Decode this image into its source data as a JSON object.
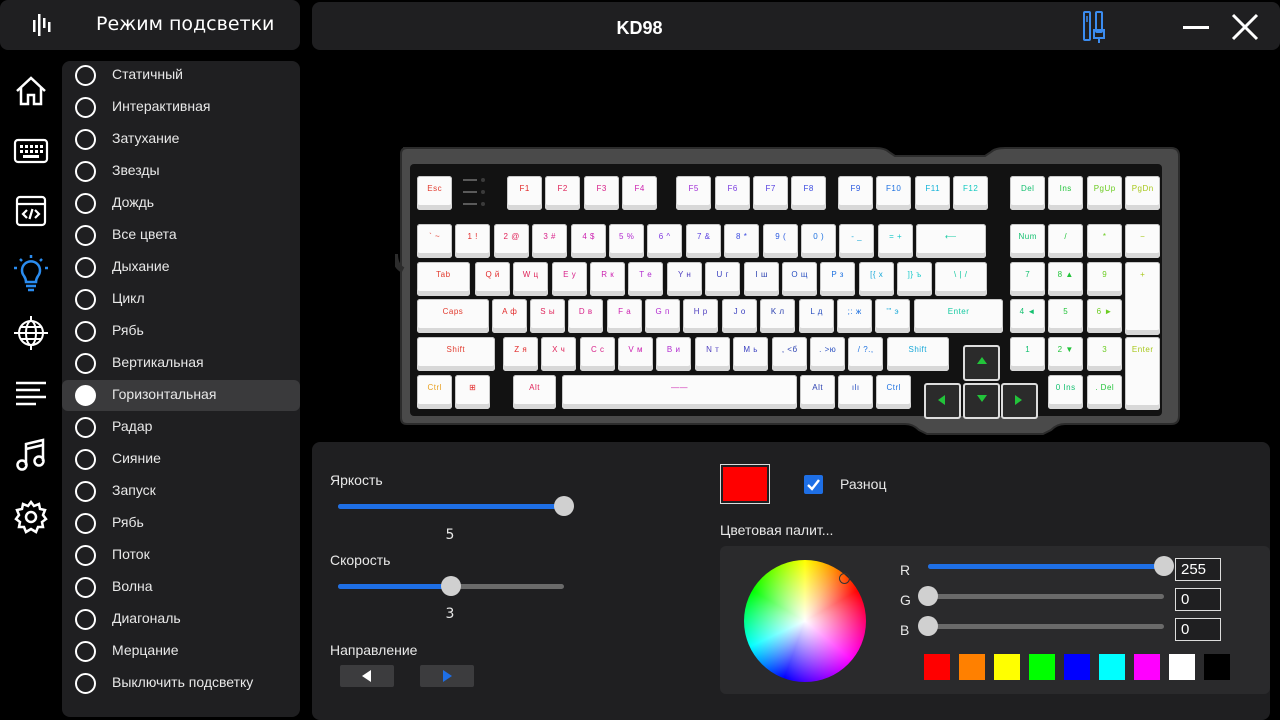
{
  "sidebar": {
    "title": "Режим подсветки",
    "nav": [
      "home-icon",
      "keyboard-icon",
      "macro-icon",
      "lighting-icon",
      "globe-icon",
      "lines-icon",
      "music-icon",
      "gear-icon"
    ]
  },
  "header": {
    "device": "KD98"
  },
  "modes": [
    {
      "label": "Статичный",
      "selected": false
    },
    {
      "label": "Интерактивная",
      "selected": false
    },
    {
      "label": "Затухание",
      "selected": false
    },
    {
      "label": "Звезды",
      "selected": false
    },
    {
      "label": "Дождь",
      "selected": false
    },
    {
      "label": "Все цвета",
      "selected": false
    },
    {
      "label": "Дыхание",
      "selected": false
    },
    {
      "label": "Цикл",
      "selected": false
    },
    {
      "label": "Рябь",
      "selected": false
    },
    {
      "label": "Вертикальная",
      "selected": false
    },
    {
      "label": "Горизонтальная",
      "selected": true
    },
    {
      "label": "Радар",
      "selected": false
    },
    {
      "label": "Сияние",
      "selected": false
    },
    {
      "label": "Запуск",
      "selected": false
    },
    {
      "label": "Рябь",
      "selected": false
    },
    {
      "label": "Поток",
      "selected": false
    },
    {
      "label": "Волна",
      "selected": false
    },
    {
      "label": "Диагональ",
      "selected": false
    },
    {
      "label": "Мерцание",
      "selected": false
    },
    {
      "label": "Выключить подсветку",
      "selected": false
    }
  ],
  "controls": {
    "brightness": {
      "label": "Яркость",
      "value": "5",
      "fraction": 1.0
    },
    "speed": {
      "label": "Скорость",
      "value": "3",
      "fraction": 0.5
    },
    "direction": {
      "label": "Направление"
    },
    "color_hex": "#ff0000",
    "multicolor": {
      "label": "Разноц",
      "checked": true
    },
    "palette_label": "Цветовая палит...",
    "r": {
      "label": "R",
      "value": "255",
      "fraction": 1.0
    },
    "g": {
      "label": "G",
      "value": "0",
      "fraction": 0
    },
    "b": {
      "label": "B",
      "value": "0",
      "fraction": 0
    },
    "swatches": [
      "#ff0000",
      "#ff8000",
      "#ffff00",
      "#00ff00",
      "#0000ff",
      "#00ffff",
      "#ff00ff",
      "#ffffff",
      "#000000"
    ]
  },
  "keyboard": {
    "rows": [
      [
        [
          "Esc",
          "#e23b2e"
        ],
        [
          "F1",
          "#e22a2a"
        ],
        [
          "F2",
          "#e0245a"
        ],
        [
          "F3",
          "#d8238a"
        ],
        [
          "F4",
          "#cc22b0"
        ],
        [
          "F5",
          "#a22fd6"
        ],
        [
          "F6",
          "#7a3be0"
        ],
        [
          "F7",
          "#5640e0"
        ],
        [
          "F8",
          "#3a4ae0"
        ],
        [
          "F9",
          "#2a5ae0"
        ],
        [
          "F10",
          "#1f72e0"
        ],
        [
          "F11",
          "#15b3d8"
        ],
        [
          "F12",
          "#12c9c0"
        ],
        [
          "Del",
          "#14c070"
        ],
        [
          "Ins",
          "#22c43a"
        ],
        [
          "PgUp",
          "#6ccc22"
        ],
        [
          "PgDn",
          "#a8c81c"
        ]
      ],
      [
        [
          "` ~",
          "#e23b2e"
        ],
        [
          "1 !",
          "#e22a2a"
        ],
        [
          "2 @",
          "#e0245a"
        ],
        [
          "3 #",
          "#d8238a"
        ],
        [
          "4 $",
          "#cc22b0"
        ],
        [
          "5 %",
          "#b22cd0"
        ],
        [
          "6 ^",
          "#8038e0"
        ],
        [
          "7 &",
          "#5a40e0"
        ],
        [
          "8 *",
          "#3a4ae0"
        ],
        [
          "9 (",
          "#2a5ae0"
        ],
        [
          "0 )",
          "#1f72e0"
        ],
        [
          "- _",
          "#18a8d8"
        ],
        [
          "= +",
          "#14c8c8"
        ],
        [
          "⟵",
          "#12c9a0"
        ],
        [
          "Num",
          "#14c070"
        ],
        [
          "/",
          "#22c43a"
        ],
        [
          "*",
          "#6ccc22"
        ],
        [
          "−",
          "#a8c81c"
        ]
      ],
      [
        [
          "Tab",
          "#e23b2e"
        ],
        [
          "Q й",
          "#e22a2a"
        ],
        [
          "W ц",
          "#e0245a"
        ],
        [
          "E у",
          "#d8238a"
        ],
        [
          "R к",
          "#cc22b0"
        ],
        [
          "T е",
          "#b22cd0"
        ],
        [
          "Y н",
          "#5040c0"
        ],
        [
          "U г",
          "#3a40c0"
        ],
        [
          "I ш",
          "#2a40b0"
        ],
        [
          "O щ",
          "#2a50c0"
        ],
        [
          "P з",
          "#1f72e0"
        ],
        [
          "[{ х",
          "#18a8d8"
        ],
        [
          "]} ъ",
          "#14c8c8"
        ],
        [
          "\\ | /",
          "#12c9a0"
        ],
        [
          "7",
          "#14c070"
        ],
        [
          "8 ▲",
          "#22c43a"
        ],
        [
          "9",
          "#6ccc22"
        ],
        [
          "+",
          "#a8c81c"
        ]
      ],
      [
        [
          "Caps",
          "#e23b2e"
        ],
        [
          "A ф",
          "#e22a2a"
        ],
        [
          "S ы",
          "#e0245a"
        ],
        [
          "D в",
          "#d8238a"
        ],
        [
          "F а",
          "#cc22b0"
        ],
        [
          "G п",
          "#b22cd0"
        ],
        [
          "H р",
          "#5040c0"
        ],
        [
          "J о",
          "#3a40c0"
        ],
        [
          "K л",
          "#2a40b0"
        ],
        [
          "L д",
          "#2a50c0"
        ],
        [
          ";: ж",
          "#1f72e0"
        ],
        [
          "'\" э",
          "#18a8d8"
        ],
        [
          "Enter",
          "#12c9a0"
        ],
        [
          "4 ◄",
          "#14c070"
        ],
        [
          "5",
          "#22c43a"
        ],
        [
          "6 ►",
          "#6ccc22"
        ]
      ],
      [
        [
          "Shift",
          "#e23b2e"
        ],
        [
          "Z я",
          "#e22a2a"
        ],
        [
          "X ч",
          "#e0245a"
        ],
        [
          "C с",
          "#d8238a"
        ],
        [
          "V м",
          "#cc22b0"
        ],
        [
          "B и",
          "#b22cd0"
        ],
        [
          "N т",
          "#5040c0"
        ],
        [
          "M ь",
          "#3a40c0"
        ],
        [
          ", <б",
          "#2a40b0"
        ],
        [
          ". >ю",
          "#2a50c0"
        ],
        [
          "/ ?.,",
          "#1f72e0"
        ],
        [
          "Shift",
          "#18a8d8"
        ],
        [
          "1",
          "#14c070"
        ],
        [
          "2 ▼",
          "#22c43a"
        ],
        [
          "3",
          "#6ccc22"
        ],
        [
          "Enter",
          "#a8c81c"
        ]
      ],
      [
        [
          "Ctrl",
          "#e8a020"
        ],
        [
          "⊞",
          "#e22a2a"
        ],
        [
          "Alt",
          "#e0245a"
        ],
        [
          "——",
          "#cc22b0"
        ],
        [
          "Alt",
          "#2a40b0"
        ],
        [
          "ılı",
          "#2a50c0"
        ],
        [
          "Ctrl",
          "#1f72e0"
        ],
        [
          "0 Ins",
          "#14c070"
        ],
        [
          ". Del",
          "#22c43a"
        ]
      ]
    ]
  }
}
